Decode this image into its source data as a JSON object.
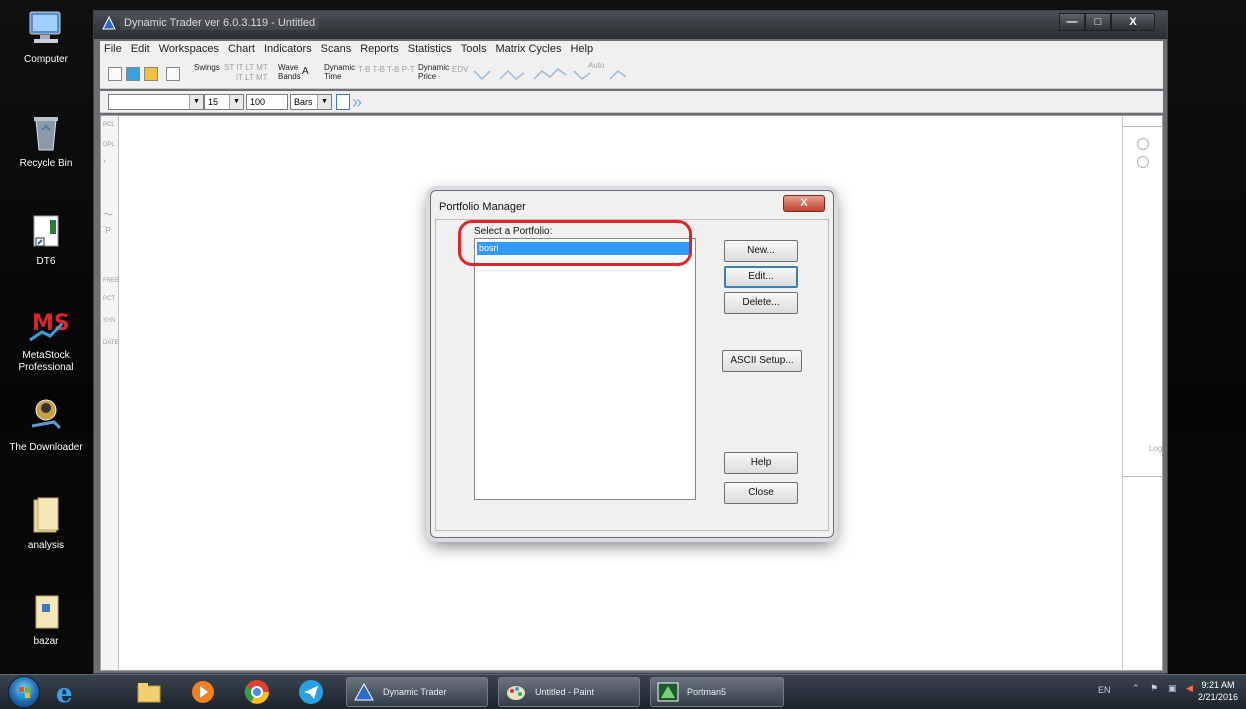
{
  "desktop": {
    "icons": [
      {
        "label": "Computer",
        "icon": "computer-icon"
      },
      {
        "label": "Recycle Bin",
        "icon": "recycle-bin-icon"
      },
      {
        "label": "DT6",
        "icon": "dt6-shortcut-icon"
      },
      {
        "label": "MetaStock Professional",
        "icon": "metastock-icon"
      },
      {
        "label": "The Downloader",
        "icon": "downloader-icon"
      },
      {
        "label": "analysis",
        "icon": "folder-icon"
      },
      {
        "label": "bazar",
        "icon": "folder-icon"
      }
    ]
  },
  "app": {
    "title": "Dynamic Trader ver 6.0.3.119 - Untitled",
    "window_buttons": {
      "minimize": "—",
      "maximize": "□",
      "close": "X"
    },
    "menu": [
      "File",
      "Edit",
      "Workspaces",
      "Chart",
      "Indicators",
      "Scans",
      "Reports",
      "Statistics",
      "Tools",
      "Matrix Cycles",
      "Help"
    ],
    "toolbar1": {
      "swings": "Swings",
      "st_lt": "ST  IT  LT MT",
      "it_lt": "IT  LT MT",
      "wave": "Wave",
      "bands": "Bands",
      "a_label": "A",
      "dynamic_time_1": "Dynamic",
      "dynamic_time_2": "Time",
      "time_projections": "T-B  T-B  T-B  P-T",
      "dynamic_price_1": "Dynamic",
      "dynamic_price_2": "Price",
      "edv": "EDV",
      "auto": "Auto"
    },
    "toolbar2": {
      "symbol_combo": "",
      "period_combo": "15",
      "bars_count_combo": "100",
      "bars_type_combo": "Bars"
    },
    "left_strip": [
      "PCL",
      "DPL",
      "FREE",
      "PCT",
      "SYN",
      "DATE"
    ],
    "right_strip": {
      "log_label": "Log"
    }
  },
  "dialog": {
    "title": "Portfolio Manager",
    "close_label": "X",
    "list_label": "Select a Portfolio:",
    "portfolios": [
      "bosri"
    ],
    "buttons": {
      "new": "New...",
      "edit": "Edit...",
      "delete": "Delete...",
      "ascii_setup": "ASCII Setup...",
      "help": "Help",
      "close": "Close"
    }
  },
  "taskbar": {
    "tasks": [
      {
        "label": "Dynamic Trader",
        "icon": "dynamic-trader-icon"
      },
      {
        "label": "Untitled - Paint",
        "icon": "paint-icon"
      },
      {
        "label": "Portman5",
        "icon": "portman-icon"
      }
    ],
    "clock_time": "9:21 AM",
    "clock_date": "2/21/2016",
    "language": "EN"
  },
  "colors": {
    "selection": "#3399ff",
    "annotation_red": "#e32526",
    "dialog_close": "#c4422b"
  }
}
